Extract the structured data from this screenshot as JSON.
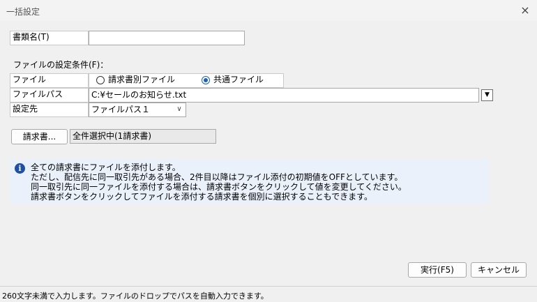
{
  "window": {
    "title": "一括設定",
    "close": "×"
  },
  "fields": {
    "doc_name_label": "書類名(T)",
    "doc_name_value": "",
    "section_label": "ファイルの設定条件(F)：",
    "file_label": "ファイル",
    "radio_per_invoice": "請求書別ファイル",
    "radio_common": "共通ファイル",
    "radio_selected": "共通ファイル",
    "filepath_label": "ファイルパス",
    "filepath_value": "C:¥セールのお知らせ.txt",
    "target_label": "設定先",
    "target_value": "ファイルパス１"
  },
  "invoice": {
    "button_label": "請求書...",
    "selection_text": "全件選択中(1請求書)"
  },
  "info": {
    "lines": [
      "全ての請求書にファイルを添付します。",
      "ただし、配信先に同一取引先がある場合、2件目以降はファイル添付の初期値をOFFとしています。",
      "同一取引先に同一ファイルを添付する場合は、請求書ボタンをクリックして値を変更してください。",
      "請求書ボタンをクリックしてファイルを添付する請求書を個別に選択することもできます。"
    ]
  },
  "buttons": {
    "execute": "実行(F5)",
    "cancel": "キャンセル"
  },
  "status": {
    "text": "260文字未満で入力します。ファイルのドロップでパスを自動入力できます。"
  },
  "icons": {
    "info": "info-icon",
    "dropdown": "chevron-down-icon"
  },
  "colors": {
    "accent": "#1f5fb5",
    "info_bg": "#eaf1fb"
  }
}
